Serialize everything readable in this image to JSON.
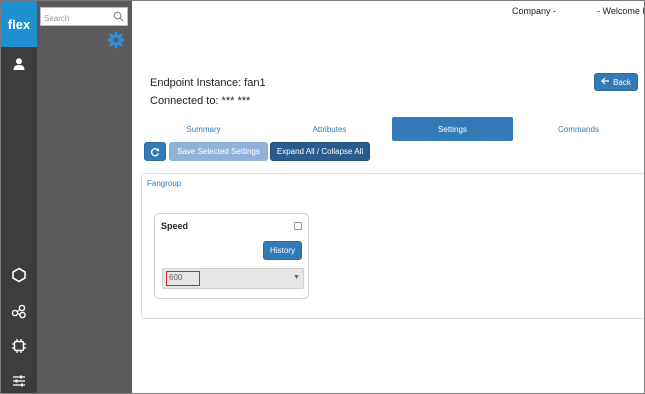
{
  "app": {
    "logo": "flex"
  },
  "rail": {
    "icons": [
      "user-icon",
      "hexagon-icon",
      "nodes-icon",
      "chip-icon",
      "sliders-icon"
    ]
  },
  "sidebar": {
    "search_placeholder": "Search",
    "icons": [
      "search-icon",
      "gear-icon"
    ]
  },
  "topbar": {
    "company_label": "Company -",
    "welcome_label": "- Welcome",
    "welcome_initial": "M"
  },
  "page": {
    "title": "Endpoint Instance: fan1",
    "subtitle": "Connected to: *** ***",
    "back_label": "Back"
  },
  "tabs": [
    {
      "label": "Summary",
      "active": false
    },
    {
      "label": "Attributes",
      "active": false
    },
    {
      "label": "Settings",
      "active": true
    },
    {
      "label": "Commands",
      "active": false
    }
  ],
  "toolbar": {
    "save_label": "Save Selected Settings",
    "expand_label": "Expand All / Collapse All"
  },
  "panel": {
    "group_title": "Fangroup",
    "setting": {
      "label": "Speed",
      "history_label": "History",
      "value": "600"
    }
  },
  "colors": {
    "brand": "#1e8fd0",
    "primary": "#337ab7",
    "dark_primary": "#295c8e",
    "rail_bg": "#3d3d3d",
    "sidebar_bg": "#5b5b5b",
    "highlight": "#e02020"
  }
}
